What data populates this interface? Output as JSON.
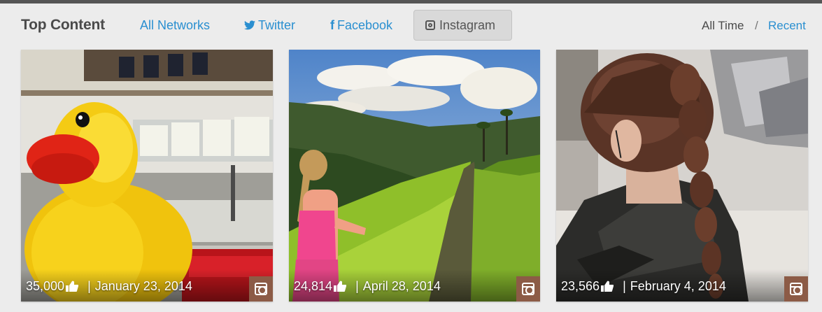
{
  "header": {
    "title": "Top Content",
    "tabs": [
      {
        "label": "All Networks"
      },
      {
        "label": "Twitter",
        "icon": "twitter-icon"
      },
      {
        "label": "Facebook",
        "icon": "facebook-icon"
      },
      {
        "label": "Instagram",
        "icon": "instagram-icon",
        "active": true
      }
    ],
    "time_filters": {
      "all_time": "All Time",
      "separator": "/",
      "recent": "Recent"
    }
  },
  "posts": [
    {
      "likes": "35,000",
      "sep": "|",
      "date": "January 23, 2014",
      "image": "yellow rubber duck in atrium",
      "network": "instagram-icon"
    },
    {
      "likes": "24,814",
      "sep": "|",
      "date": "April 28, 2014",
      "image": "woman running on jungle trail",
      "network": "instagram-icon"
    },
    {
      "likes": "23,566",
      "sep": "|",
      "date": "February 4, 2014",
      "image": "braided hair with ear tattoo",
      "network": "instagram-icon"
    }
  ],
  "colors": {
    "accent": "#2a8fd0",
    "badge": "#8c5b46",
    "active_tab_bg": "#d9d9d9"
  }
}
